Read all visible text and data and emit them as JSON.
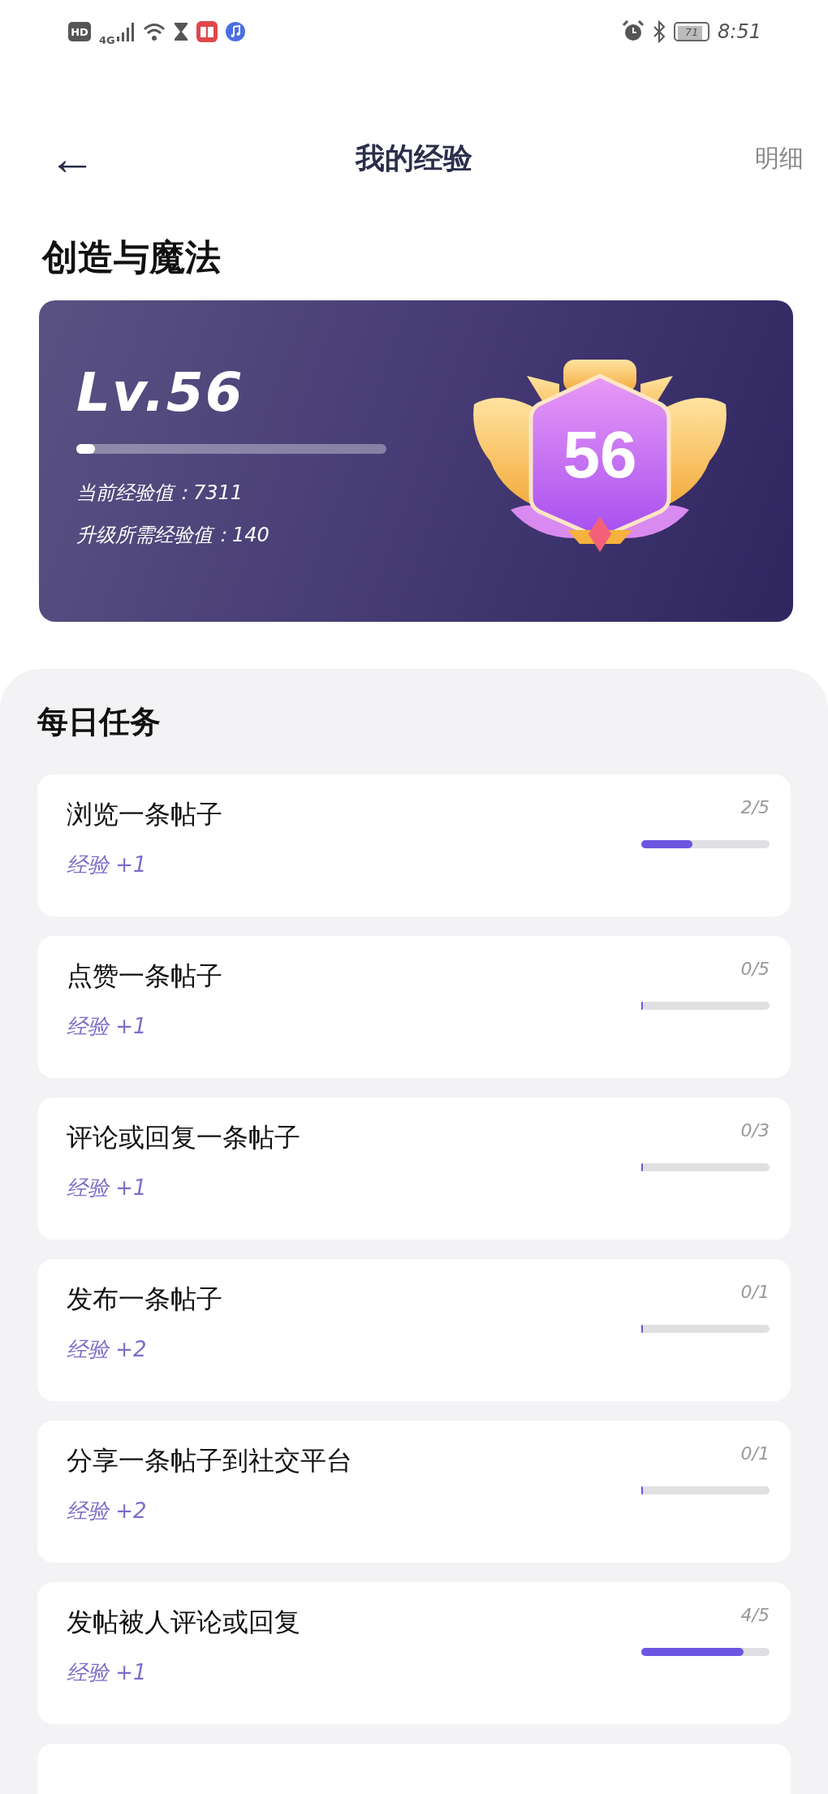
{
  "status_bar": {
    "hd": "HD",
    "network": "4G",
    "battery": "71",
    "time": "8:51"
  },
  "header": {
    "back": "←",
    "title": "我的经验",
    "action": "明细"
  },
  "group_name": "创造与魔法",
  "level_card": {
    "level_label": "Lv.56",
    "level": 0.06,
    "current": "当前经验值：7311",
    "needed": "升级所需经验值：140",
    "badge_number": "56"
  },
  "daily": {
    "title": "每日任务",
    "tasks": [
      {
        "name": "浏览一条帖子",
        "reward": "经验 +1",
        "count": "2/5",
        "level": 0.4
      },
      {
        "name": "点赞一条帖子",
        "reward": "经验 +1",
        "count": "0/5",
        "level": 0
      },
      {
        "name": "评论或回复一条帖子",
        "reward": "经验 +1",
        "count": "0/3",
        "level": 0
      },
      {
        "name": "发布一条帖子",
        "reward": "经验 +2",
        "count": "0/1",
        "level": 0
      },
      {
        "name": "分享一条帖子到社交平台",
        "reward": "经验 +2",
        "count": "0/1",
        "level": 0
      },
      {
        "name": "发帖被人评论或回复",
        "reward": "经验 +1",
        "count": "4/5",
        "level": 0.8
      }
    ]
  }
}
